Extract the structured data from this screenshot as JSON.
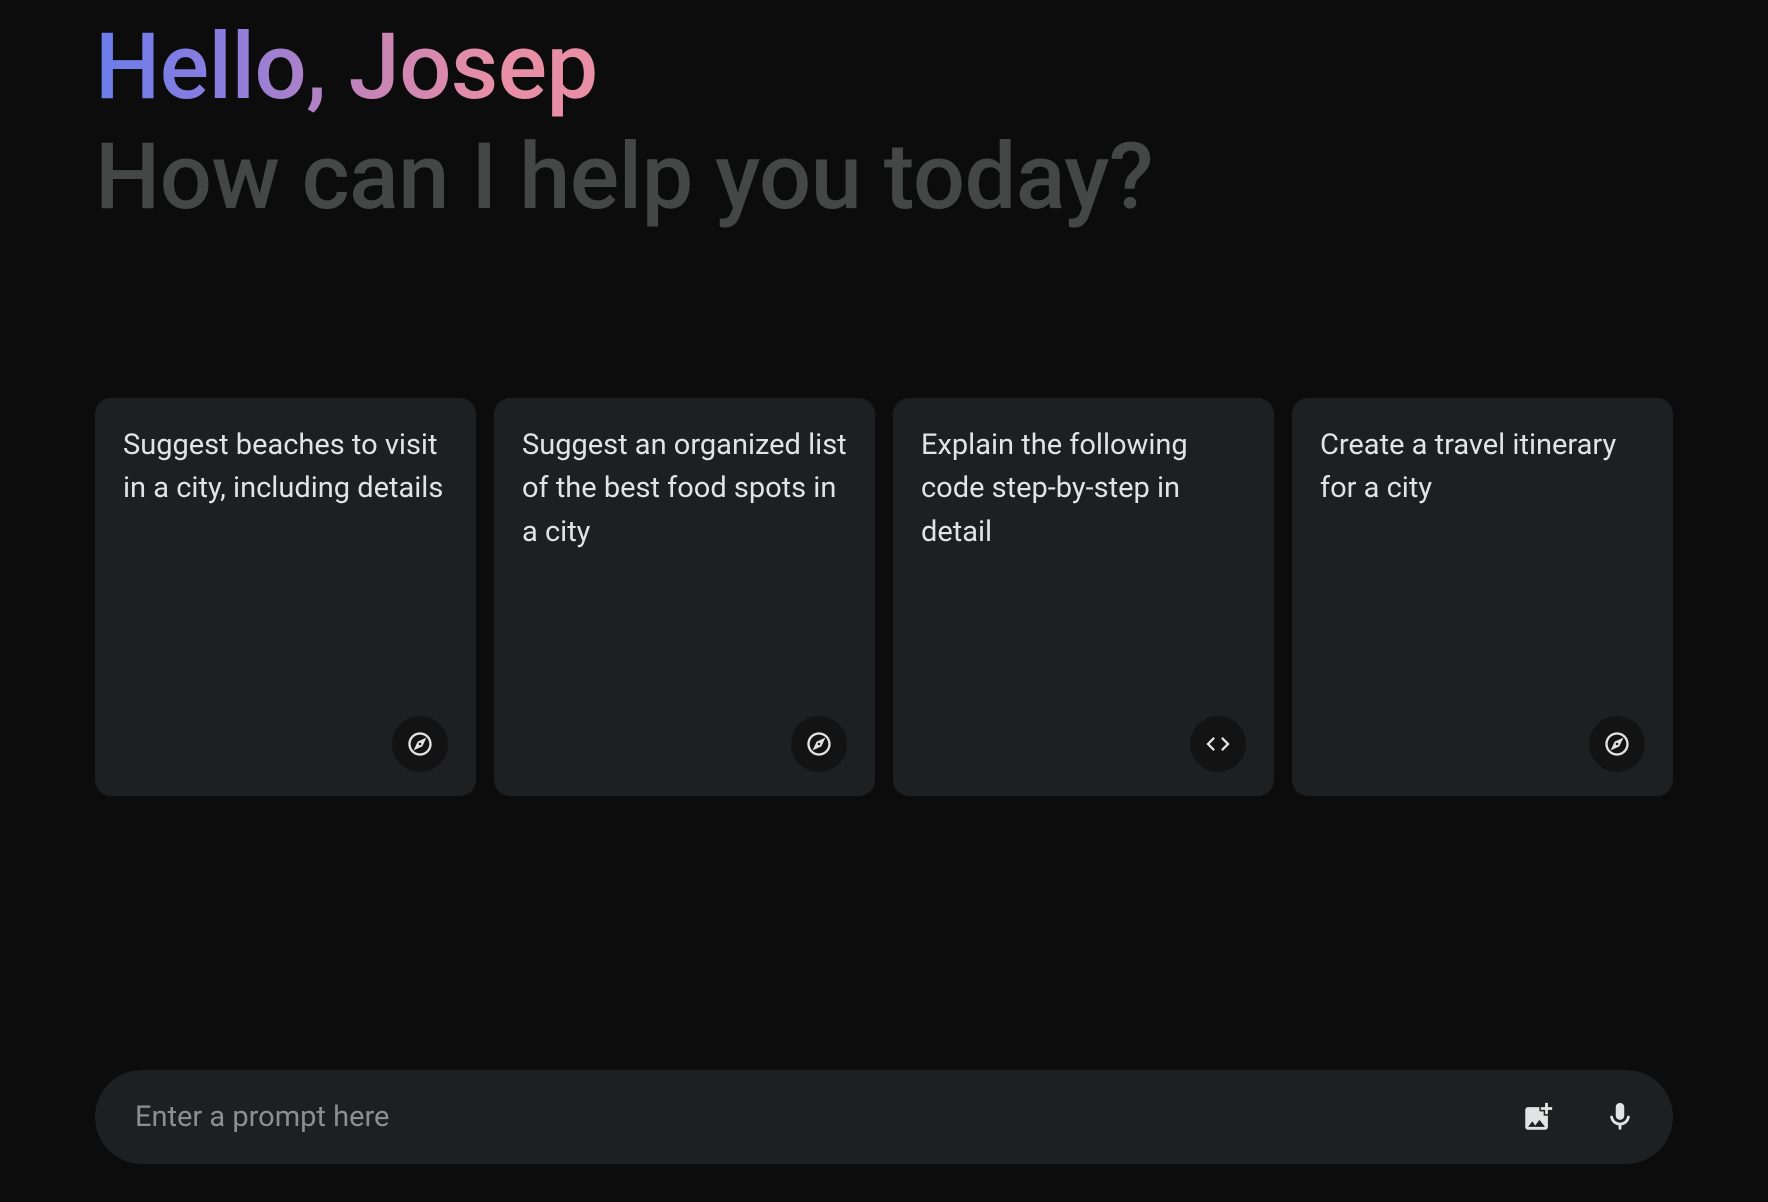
{
  "greeting": {
    "hello": "Hello, Josep",
    "subtitle": "How can I help you today?"
  },
  "cards": [
    {
      "text": "Suggest beaches to visit in a city, including details",
      "icon": "compass"
    },
    {
      "text": "Suggest an organized list of the best food spots in a city",
      "icon": "compass"
    },
    {
      "text": "Explain the following code step-by-step in detail",
      "icon": "code"
    },
    {
      "text": "Create a travel itinerary for a city",
      "icon": "compass"
    }
  ],
  "input": {
    "placeholder": "Enter a prompt here"
  }
}
